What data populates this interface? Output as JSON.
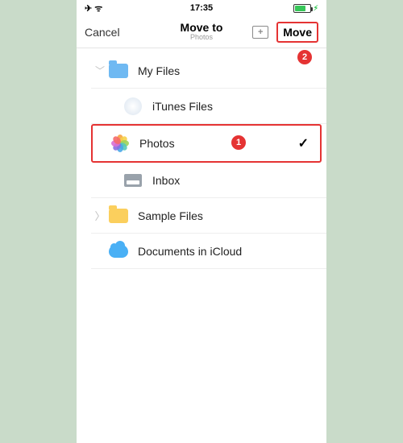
{
  "status": {
    "time": "17:35",
    "airplane": "✈",
    "wifi": "ᯤ",
    "bolt": "⚡︎"
  },
  "nav": {
    "cancel": "Cancel",
    "title": "Move to",
    "subtitle": "Photos",
    "newFolderPlus": "+",
    "move": "Move"
  },
  "annotations": {
    "badge1": "1",
    "badge2": "2"
  },
  "rows": {
    "myFiles": {
      "label": "My Files",
      "chevron": "﹀"
    },
    "itunes": {
      "label": "iTunes Files"
    },
    "photos": {
      "label": "Photos",
      "check": "✓"
    },
    "inbox": {
      "label": "Inbox"
    },
    "sample": {
      "label": "Sample Files",
      "chevron": "〉"
    },
    "icloud": {
      "label": "Documents in iCloud"
    }
  },
  "petalColors": [
    "#f6a540",
    "#f6d24a",
    "#9fd35a",
    "#58c9b9",
    "#49a7e8",
    "#8a6fe0",
    "#d96fd3",
    "#f56a6a"
  ]
}
